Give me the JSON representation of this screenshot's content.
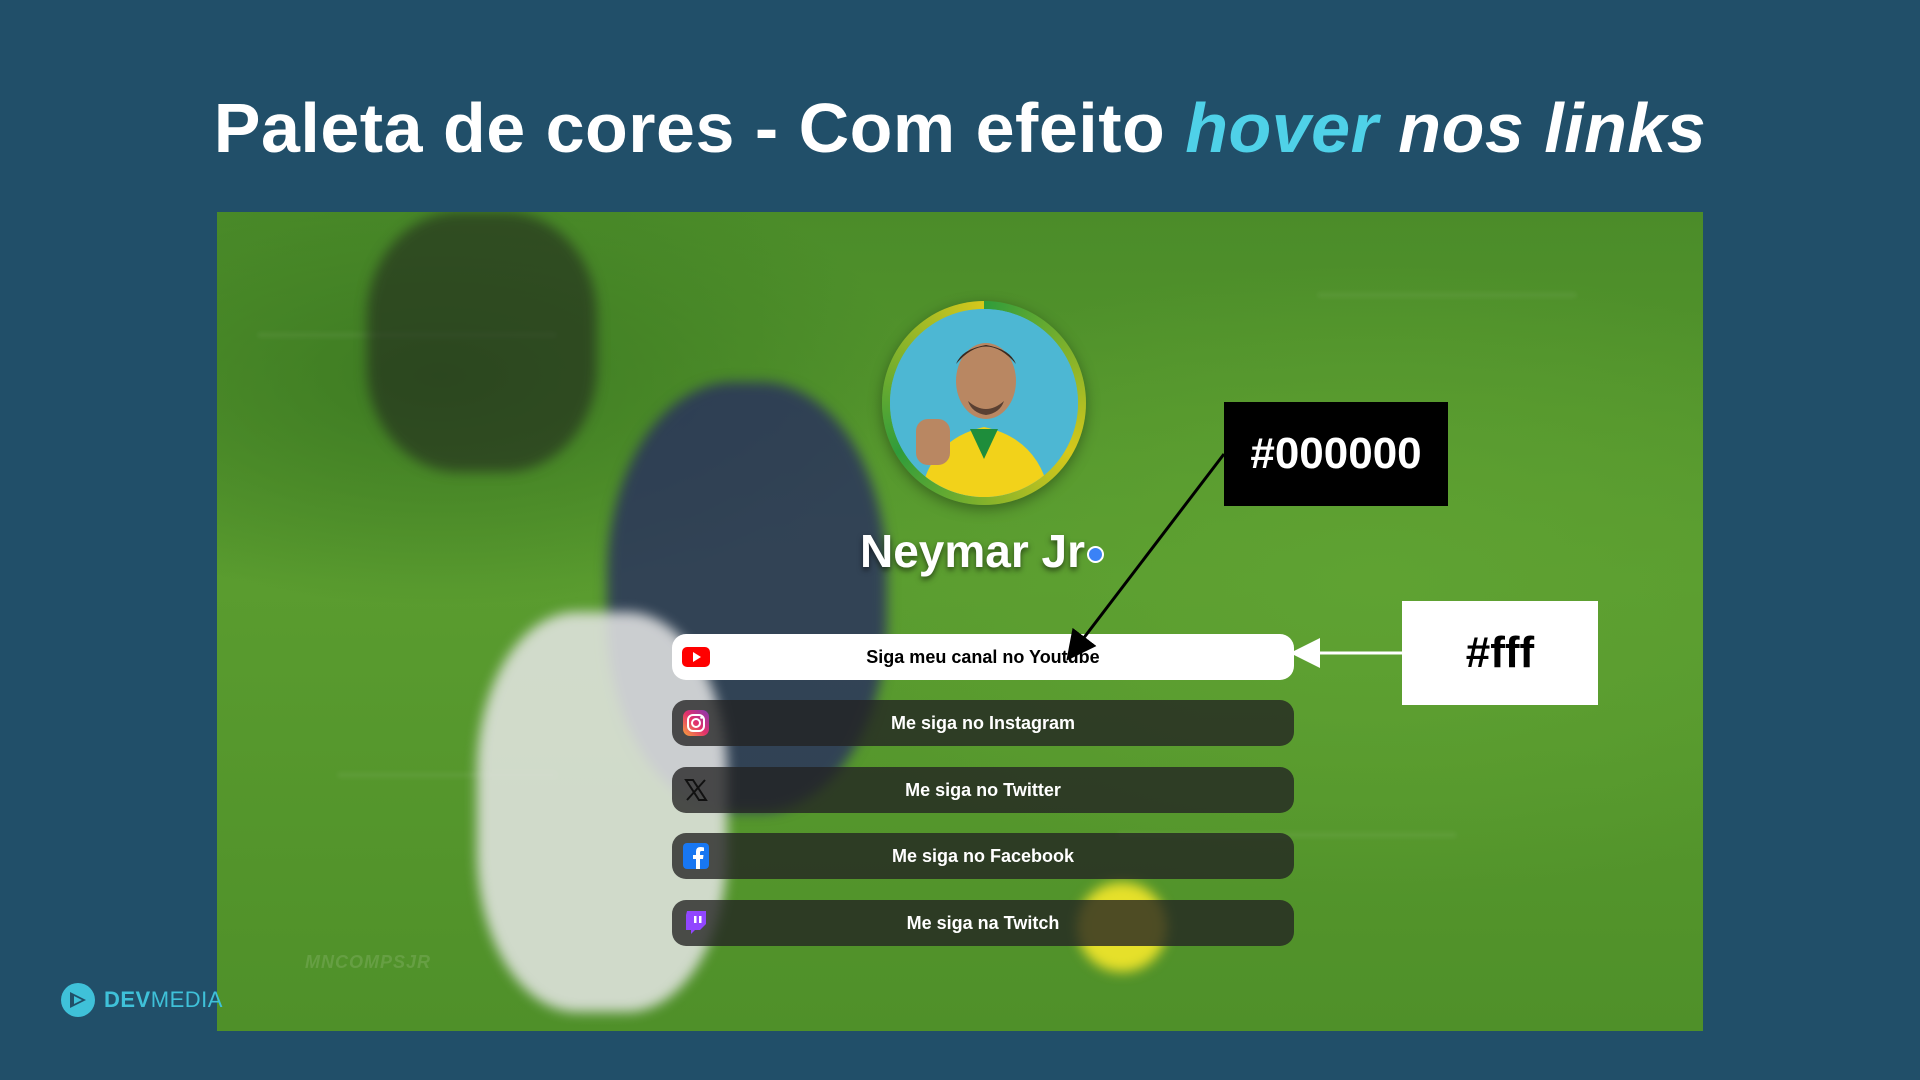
{
  "title": {
    "part1": "Paleta de cores - Com efeito ",
    "accent": "hover",
    "part2": " nos links"
  },
  "profile": {
    "name": "Neymar Jr",
    "avatar_icon": "neymar-avatar-photo",
    "verified_icon": "verified-badge-icon"
  },
  "links": [
    {
      "label": "Siga meu canal no Youtube",
      "icon": "youtube-icon",
      "state": "hover"
    },
    {
      "label": "Me siga no Instagram",
      "icon": "instagram-icon",
      "state": "normal"
    },
    {
      "label": "Me siga no Twitter",
      "icon": "x-twitter-icon",
      "state": "normal"
    },
    {
      "label": "Me siga no Facebook",
      "icon": "facebook-icon",
      "state": "normal"
    },
    {
      "label": "Me siga na Twitch",
      "icon": "twitch-icon",
      "state": "normal"
    }
  ],
  "callouts": {
    "dark_color": "#000000",
    "light_color": "#fff"
  },
  "watermark": "MNCOMPSJR",
  "brand": {
    "part1": "DEV",
    "part2": "MEDIA"
  },
  "colors": {
    "slide_bg": "#214f69",
    "title_accent": "#4fd1e8",
    "link_bg": "#000000",
    "link_hover_bg": "#fff",
    "youtube": "#ff0000",
    "facebook": "#1877f2",
    "twitch": "#9146ff"
  }
}
